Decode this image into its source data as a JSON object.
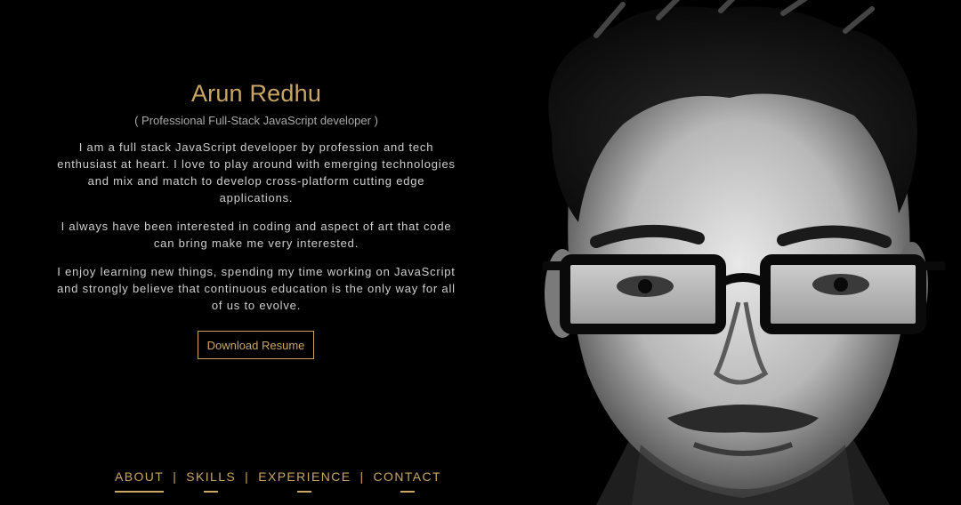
{
  "profile": {
    "name": "Arun Redhu",
    "subtitle": "( Professional Full-Stack JavaScript developer )",
    "bio": [
      "I am a full stack JavaScript developer by profession and tech enthusiast at heart. I love to play around with emerging technologies and mix and match to develop cross-platform cutting edge applications.",
      "I always have been interested in coding and aspect of art that code can bring make me very interested.",
      "I enjoy learning new things, spending my time working on JavaScript and strongly believe that continuous education is the only way for all of us to evolve."
    ],
    "download_label": "Download Resume"
  },
  "nav": {
    "items": [
      "ABOUT",
      "SKILLS",
      "EXPERIENCE",
      "CONTACT"
    ],
    "separator": "|",
    "active": "ABOUT"
  },
  "colors": {
    "accent": "#c9a566",
    "background": "#000000",
    "text": "#cfcfcf"
  }
}
